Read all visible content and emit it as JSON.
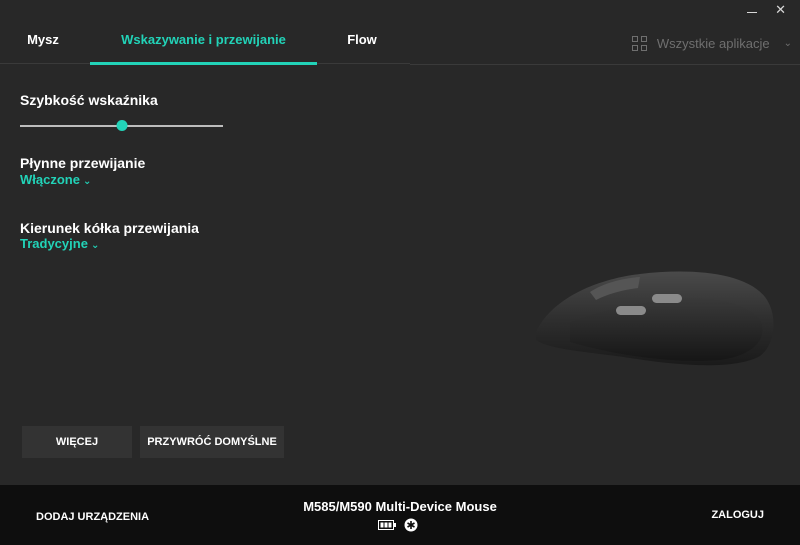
{
  "window": {
    "minimize_icon": "minimize-icon",
    "close_symbol": "✕"
  },
  "tabs": [
    {
      "label": "Mysz",
      "active": false
    },
    {
      "label": "Wskazywanie i przewijanie",
      "active": true
    },
    {
      "label": "Flow",
      "active": false
    }
  ],
  "apps": {
    "label": "Wszystkie aplikacje",
    "icon": "grid-icon"
  },
  "settings": {
    "pointer_speed": {
      "label": "Szybkość wskaźnika",
      "value": 0.5
    },
    "smooth_scroll": {
      "label": "Płynne przewijanie",
      "value": "Włączone"
    },
    "scroll_direction": {
      "label": "Kierunek kółka przewijania",
      "value": "Tradycyjne"
    }
  },
  "buttons": {
    "more": "WIĘCEJ",
    "reset": "PRZYWRÓĆ DOMYŚLNE"
  },
  "footer": {
    "add_device": "DODAJ URZĄDZENIA",
    "device_name": "M585/M590 Multi-Device Mouse",
    "login": "ZALOGUJ"
  },
  "colors": {
    "accent": "#22d3b8",
    "background": "#282828",
    "footer": "#0e0e0e"
  }
}
